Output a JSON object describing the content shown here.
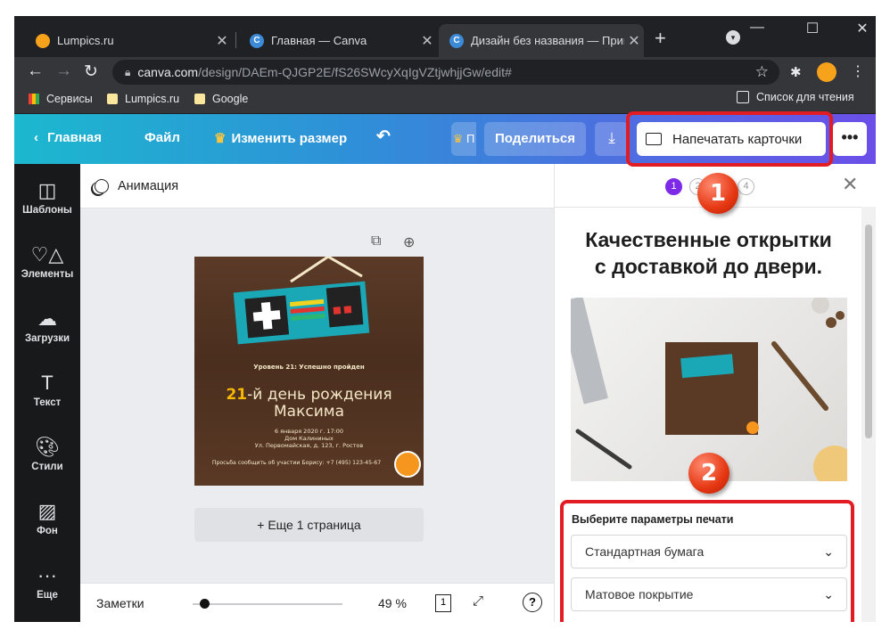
{
  "browser": {
    "tabs": [
      {
        "title": "Lumpics.ru",
        "favicon": "orange-icon",
        "active": false
      },
      {
        "title": "Главная — Canva",
        "favicon": "canva-icon",
        "active": false
      },
      {
        "title": "Дизайн без названия — Пригл",
        "favicon": "canva-icon",
        "active": true
      }
    ],
    "new_tab": "+",
    "url_host": "canva.com",
    "url_path": "/design/DAEm-QJGP2E/fS26SWcyXqIgVZtjwhjjGw/edit#",
    "bookmarks": [
      {
        "label": "Сервисы",
        "icon": "apps-grid-icon"
      },
      {
        "label": "Lumpics.ru",
        "icon": "folder-icon"
      },
      {
        "label": "Google",
        "icon": "folder-icon"
      }
    ],
    "reading_list": "Список для чтения"
  },
  "canva_header": {
    "home": "Главная",
    "file": "Файл",
    "resize": "Изменить размер",
    "partial_button": "П",
    "share": "Поделиться",
    "print_cards": "Напечатать карточки",
    "more": "•••"
  },
  "sidebar": {
    "items": [
      {
        "label": "Шаблоны",
        "icon": "templates-icon"
      },
      {
        "label": "Элементы",
        "icon": "elements-icon"
      },
      {
        "label": "Загрузки",
        "icon": "uploads-icon"
      },
      {
        "label": "Текст",
        "icon": "text-icon"
      },
      {
        "label": "Стили",
        "icon": "styles-icon"
      },
      {
        "label": "Фон",
        "icon": "background-icon"
      },
      {
        "label": "Еще",
        "icon": "more-icon"
      }
    ]
  },
  "editor": {
    "animation": "Анимация",
    "card": {
      "level": "Уровень 21: Успешно пройден",
      "birthday_num": "21",
      "birthday_rest": "-й день рождения",
      "name": "Максима",
      "date": "6 января 2020 г. 17:00",
      "place1": "Дом Калининых",
      "place2": "Ул. Первомайская, д. 123, г. Ростов",
      "rsvp": "Просьба сообщить об участии Борису: +7 (495) 123-45-67"
    },
    "add_page": "+ Еще 1 страница",
    "notes": "Заметки",
    "zoom": "49 %",
    "page_count": "1",
    "help": "?",
    "zoom_fraction": 0.05
  },
  "print_panel": {
    "steps": [
      "1",
      "2",
      "3",
      "4"
    ],
    "active_step": 1,
    "heading_line1": "Качественные открытки",
    "heading_line2": "с доставкой до двери.",
    "options_label": "Выберите параметры печати",
    "paper": "Стандартная бумага",
    "finish": "Матовое покрытие"
  },
  "annotations": {
    "badge1": "1",
    "badge2": "2",
    "color": "#e31b23"
  },
  "colors": {
    "canva_purple": "#7d2ae8",
    "header_gradient_start": "#1cb8cf",
    "header_gradient_end": "#6b4fe8"
  }
}
